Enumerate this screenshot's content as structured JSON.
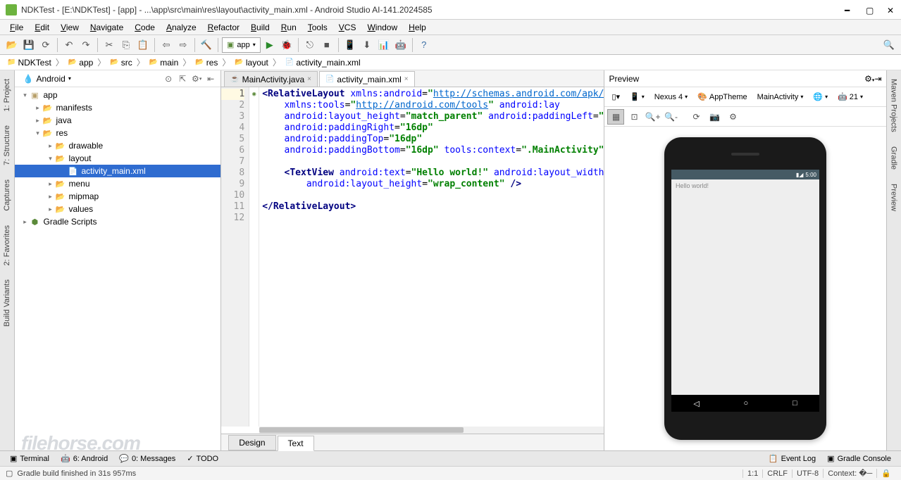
{
  "window": {
    "title": "NDKTest - [E:\\NDKTest] - [app] - ...\\app\\src\\main\\res\\layout\\activity_main.xml - Android Studio AI-141.2024585"
  },
  "menus": [
    "File",
    "Edit",
    "View",
    "Navigate",
    "Code",
    "Analyze",
    "Refactor",
    "Build",
    "Run",
    "Tools",
    "VCS",
    "Window",
    "Help"
  ],
  "toolbar": {
    "module": "app"
  },
  "breadcrumbs": [
    "NDKTest",
    "app",
    "src",
    "main",
    "res",
    "layout",
    "activity_main.xml"
  ],
  "side_left": [
    {
      "n": "1: Project"
    },
    {
      "n": "7: Structure"
    },
    {
      "n": "Captures"
    },
    {
      "n": "2: Favorites"
    },
    {
      "n": "Build Variants"
    }
  ],
  "side_right": [
    {
      "n": "Maven Projects"
    },
    {
      "n": "Gradle"
    },
    {
      "n": "Preview"
    }
  ],
  "project": {
    "view": "Android",
    "tree": [
      {
        "d": 0,
        "exp": true,
        "icon": "mod",
        "label": "app"
      },
      {
        "d": 1,
        "exp": false,
        "icon": "dir",
        "label": "manifests"
      },
      {
        "d": 1,
        "exp": false,
        "icon": "dir",
        "label": "java"
      },
      {
        "d": 1,
        "exp": true,
        "icon": "dir",
        "label": "res"
      },
      {
        "d": 2,
        "exp": false,
        "icon": "dir",
        "label": "drawable"
      },
      {
        "d": 2,
        "exp": true,
        "icon": "dir",
        "label": "layout"
      },
      {
        "d": 3,
        "exp": null,
        "icon": "xml",
        "label": "activity_main.xml",
        "sel": true
      },
      {
        "d": 2,
        "exp": false,
        "icon": "dir",
        "label": "menu"
      },
      {
        "d": 2,
        "exp": false,
        "icon": "dir",
        "label": "mipmap"
      },
      {
        "d": 2,
        "exp": false,
        "icon": "dir",
        "label": "values"
      },
      {
        "d": 0,
        "exp": false,
        "icon": "gradle",
        "label": "Gradle Scripts"
      }
    ]
  },
  "editor": {
    "tabs": [
      {
        "icon": "java",
        "label": "MainActivity.java",
        "active": false
      },
      {
        "icon": "xml",
        "label": "activity_main.xml",
        "active": true
      }
    ],
    "design_tabs": {
      "design": "Design",
      "text": "Text",
      "active": "Text"
    },
    "lines": 12,
    "highlight_line": 1
  },
  "code": {
    "l1a": "<",
    "l1b": "RelativeLayout ",
    "l1c": "xmlns:android",
    "l1d": "=",
    "l1e": "\"",
    "l1f": "http://schemas.android.com/apk/",
    "l2a": "xmlns:tools",
    "l2b": "=",
    "l2c": "\"",
    "l2d": "http://android.com/tools",
    "l2e": "\" ",
    "l2f": "android:lay",
    "l3a": "android:layout_height",
    "l3b": "=",
    "l3c": "\"match_parent\" ",
    "l3d": "android:paddingLeft",
    "l3e": "=",
    "l3f": "\"",
    "l4a": "android:paddingRight",
    "l4b": "=",
    "l4c": "\"16dp\"",
    "l5a": "android:paddingTop",
    "l5b": "=",
    "l5c": "\"16dp\"",
    "l6a": "android:paddingBottom",
    "l6b": "=",
    "l6c": "\"16dp\" ",
    "l6d": "tools:context",
    "l6e": "=",
    "l6f": "\".MainActivity\"",
    "l8a": "<",
    "l8b": "TextView ",
    "l8c": "android:text",
    "l8d": "=",
    "l8e": "\"Hello world!\" ",
    "l8f": "android:layout_width",
    "l9a": "android:layout_height",
    "l9b": "=",
    "l9c": "\"wrap_content\" ",
    "l9d": "/>",
    "l11a": "</",
    "l11b": "RelativeLayout",
    "l11c": ">"
  },
  "preview": {
    "title": "Preview",
    "device": "Nexus 4",
    "theme": "AppTheme",
    "activity": "MainActivity",
    "api": "21",
    "phone": {
      "time": "5:00",
      "app_text": "Hello world!"
    }
  },
  "bottom": {
    "terminal": "Terminal",
    "android": "6: Android",
    "messages": "0: Messages",
    "todo": "TODO",
    "eventlog": "Event Log",
    "gradleconsole": "Gradle Console"
  },
  "status": {
    "msg": "Gradle build finished in 31s 957ms",
    "pos": "1:1",
    "linesep": "CRLF",
    "enc": "UTF-8",
    "ctx": "Context:"
  },
  "watermark": "filehorse.com"
}
